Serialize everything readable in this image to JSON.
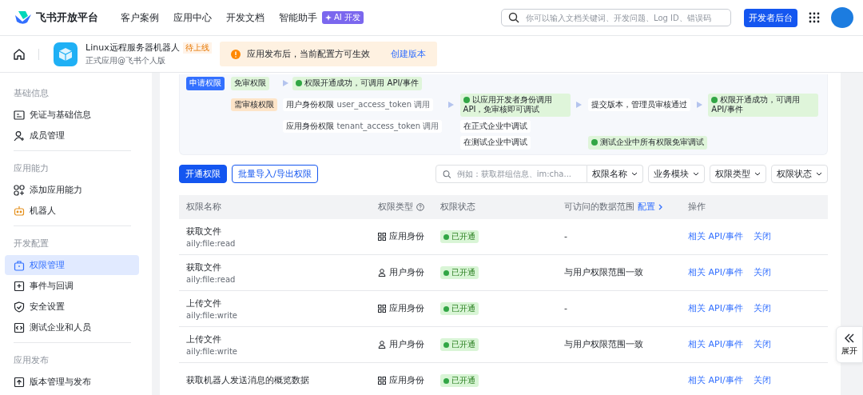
{
  "header": {
    "brand": "飞书开放平台",
    "nav": [
      {
        "label": "客户案例"
      },
      {
        "label": "应用中心"
      },
      {
        "label": "开发文档"
      },
      {
        "label": "智能助手",
        "badge": "AI 开发"
      }
    ],
    "search": {
      "placeholder": "你可以输入文档关键词、开发问题、Log ID、错误码"
    },
    "console_button": "开发者后台"
  },
  "app": {
    "name": "Linux远程服务器机器人",
    "tag": "待上线",
    "subtitle": "正式应用@飞书个人版",
    "notice": "应用发布后，当前配置方可生效",
    "notice_link": "创建版本"
  },
  "sidebar": {
    "groups": [
      {
        "title": "基础信息",
        "items": [
          {
            "label": "凭证与基础信息",
            "kind": "card",
            "selected": false
          },
          {
            "label": "成员管理",
            "kind": "user",
            "selected": false
          }
        ]
      },
      {
        "title": "应用能力",
        "items": [
          {
            "label": "添加应用能力",
            "kind": "grid",
            "selected": false
          },
          {
            "label": "机器人",
            "kind": "robot",
            "selected": false
          }
        ]
      },
      {
        "title": "开发配置",
        "items": [
          {
            "label": "权限管理",
            "kind": "lock",
            "selected": true
          },
          {
            "label": "事件与回调",
            "kind": "event",
            "selected": false
          },
          {
            "label": "安全设置",
            "kind": "shield",
            "selected": false
          },
          {
            "label": "测试企业和人员",
            "kind": "code",
            "selected": false
          }
        ]
      },
      {
        "title": "应用发布",
        "items": [
          {
            "label": "版本管理与发布",
            "kind": "upload",
            "selected": false
          }
        ]
      }
    ]
  },
  "flow": {
    "apply": "申请权限",
    "free": "免审权限",
    "free_result": "权限开通成功，可调用 API/事件",
    "review": "需审核权限",
    "user_scope": "用户身份权限",
    "user_token": "user_access_token 调用",
    "user_result": "以应用开发者身份调用 API，免审核即可调试",
    "submit": "提交版本，管理员审核通过",
    "final": "权限开通成功，可调用 API/事件",
    "app_scope": "应用身份权限",
    "app_token": "tenant_access_token 调用",
    "prod_debug": "在正式企业中调试",
    "test_debug": "在测试企业中调试",
    "test_result": "测试企业中所有权限免审调试"
  },
  "toolbar": {
    "buttons": [
      {
        "label": "开通权限",
        "kind": "primary"
      },
      {
        "label": "批量导入/导出权限",
        "kind": "outline"
      }
    ],
    "search": {
      "placeholder": "例如：获取群组信息、im:cha..."
    },
    "filters": [
      "权限名称",
      "业务模块",
      "权限类型",
      "权限状态"
    ]
  },
  "table": {
    "columns": [
      {
        "label": "权限名称"
      },
      {
        "label": "权限类型",
        "help": true
      },
      {
        "label": "权限状态"
      },
      {
        "label": "可访问的数据范围",
        "link": "配置"
      },
      {
        "label": "操作"
      }
    ],
    "rows": [
      {
        "name": "获取文件",
        "scope": "aily:file:read",
        "kind": "app",
        "type": "应用身份",
        "status": "已开通",
        "range": "-",
        "actions": [
          "相关 API/事件",
          "关闭"
        ]
      },
      {
        "name": "获取文件",
        "scope": "aily:file:read",
        "kind": "user",
        "type": "用户身份",
        "status": "已开通",
        "range": "与用户权限范围一致",
        "actions": [
          "相关 API/事件",
          "关闭"
        ]
      },
      {
        "name": "上传文件",
        "scope": "aily:file:write",
        "kind": "app",
        "type": "应用身份",
        "status": "已开通",
        "range": "-",
        "actions": [
          "相关 API/事件",
          "关闭"
        ]
      },
      {
        "name": "上传文件",
        "scope": "aily:file:write",
        "kind": "user",
        "type": "用户身份",
        "status": "已开通",
        "range": "与用户权限范围一致",
        "actions": [
          "相关 API/事件",
          "关闭"
        ]
      },
      {
        "name": "获取机器人发送消息的概览数据",
        "kind": "app",
        "type": "应用身份",
        "status": "已开通",
        "actions": [
          "相关 API/事件",
          "关闭"
        ]
      }
    ]
  },
  "expand_button": "展开"
}
